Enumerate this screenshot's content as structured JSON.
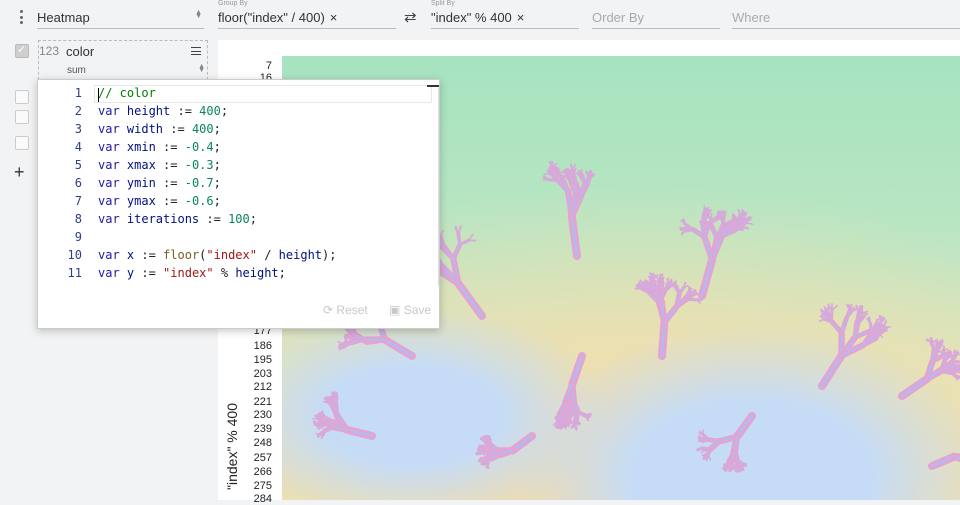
{
  "toolbar": {
    "plugin": "Heatmap",
    "group_by": {
      "caption": "Group By",
      "value": "floor(\"index\" / 400)",
      "remove": "×"
    },
    "swap_icon": "⇄",
    "split_by": {
      "caption": "Split By",
      "value": "\"index\" % 400",
      "remove": "×"
    },
    "order_by": {
      "placeholder": "Order By"
    },
    "where": {
      "placeholder": "Where"
    }
  },
  "sidebar": {
    "add": "+",
    "aggregate": {
      "type": "123",
      "name": "color",
      "fn": "sum"
    }
  },
  "editor": {
    "line_numbers": [
      "1",
      "2",
      "3",
      "4",
      "5",
      "6",
      "7",
      "8",
      "9",
      "10",
      "11"
    ],
    "lines": [
      [
        {
          "t": "// color",
          "c": "cm"
        }
      ],
      [
        {
          "t": "var ",
          "c": "kw"
        },
        {
          "t": "height",
          "c": "vr"
        },
        {
          "t": " := ",
          "c": ""
        },
        {
          "t": "400",
          "c": "num"
        },
        {
          "t": ";",
          "c": ""
        }
      ],
      [
        {
          "t": "var ",
          "c": "kw"
        },
        {
          "t": "width",
          "c": "vr"
        },
        {
          "t": " := ",
          "c": ""
        },
        {
          "t": "400",
          "c": "num"
        },
        {
          "t": ";",
          "c": ""
        }
      ],
      [
        {
          "t": "var ",
          "c": "kw"
        },
        {
          "t": "xmin",
          "c": "vr"
        },
        {
          "t": " := ",
          "c": ""
        },
        {
          "t": "-0.4",
          "c": "num"
        },
        {
          "t": ";",
          "c": ""
        }
      ],
      [
        {
          "t": "var ",
          "c": "kw"
        },
        {
          "t": "xmax",
          "c": "vr"
        },
        {
          "t": " := ",
          "c": ""
        },
        {
          "t": "-0.3",
          "c": "num"
        },
        {
          "t": ";",
          "c": ""
        }
      ],
      [
        {
          "t": "var ",
          "c": "kw"
        },
        {
          "t": "ymin",
          "c": "vr"
        },
        {
          "t": " := ",
          "c": ""
        },
        {
          "t": "-0.7",
          "c": "num"
        },
        {
          "t": ";",
          "c": ""
        }
      ],
      [
        {
          "t": "var ",
          "c": "kw"
        },
        {
          "t": "ymax",
          "c": "vr"
        },
        {
          "t": " := ",
          "c": ""
        },
        {
          "t": "-0.6",
          "c": "num"
        },
        {
          "t": ";",
          "c": ""
        }
      ],
      [
        {
          "t": "var ",
          "c": "kw"
        },
        {
          "t": "iterations",
          "c": "vr"
        },
        {
          "t": " := ",
          "c": ""
        },
        {
          "t": "100",
          "c": "num"
        },
        {
          "t": ";",
          "c": ""
        }
      ],
      [],
      [
        {
          "t": "var ",
          "c": "kw"
        },
        {
          "t": "x",
          "c": "vr"
        },
        {
          "t": " := ",
          "c": ""
        },
        {
          "t": "floor",
          "c": "fn"
        },
        {
          "t": "(",
          "c": ""
        },
        {
          "t": "\"index\"",
          "c": "str"
        },
        {
          "t": " / ",
          "c": ""
        },
        {
          "t": "height",
          "c": "vr"
        },
        {
          "t": ");",
          "c": ""
        }
      ],
      [
        {
          "t": "var ",
          "c": "kw"
        },
        {
          "t": "y",
          "c": "vr"
        },
        {
          "t": " := ",
          "c": ""
        },
        {
          "t": "\"index\"",
          "c": "str"
        },
        {
          "t": " % ",
          "c": ""
        },
        {
          "t": "height",
          "c": "vr"
        },
        {
          "t": ";",
          "c": ""
        }
      ]
    ],
    "reset": "Reset",
    "save": "Save"
  },
  "chart": {
    "ylabel": "\"index\" % 400",
    "ytick_values": [
      "7",
      "16",
      "177",
      "186",
      "195",
      "203",
      "212",
      "221",
      "230",
      "239",
      "248",
      "257",
      "266",
      "275",
      "284"
    ]
  },
  "colors": {
    "fractal": "#e6a3cf",
    "fractal_core": "#b8b8f0",
    "inner": "#c6dcf6",
    "outer": "#a6e3bf"
  }
}
